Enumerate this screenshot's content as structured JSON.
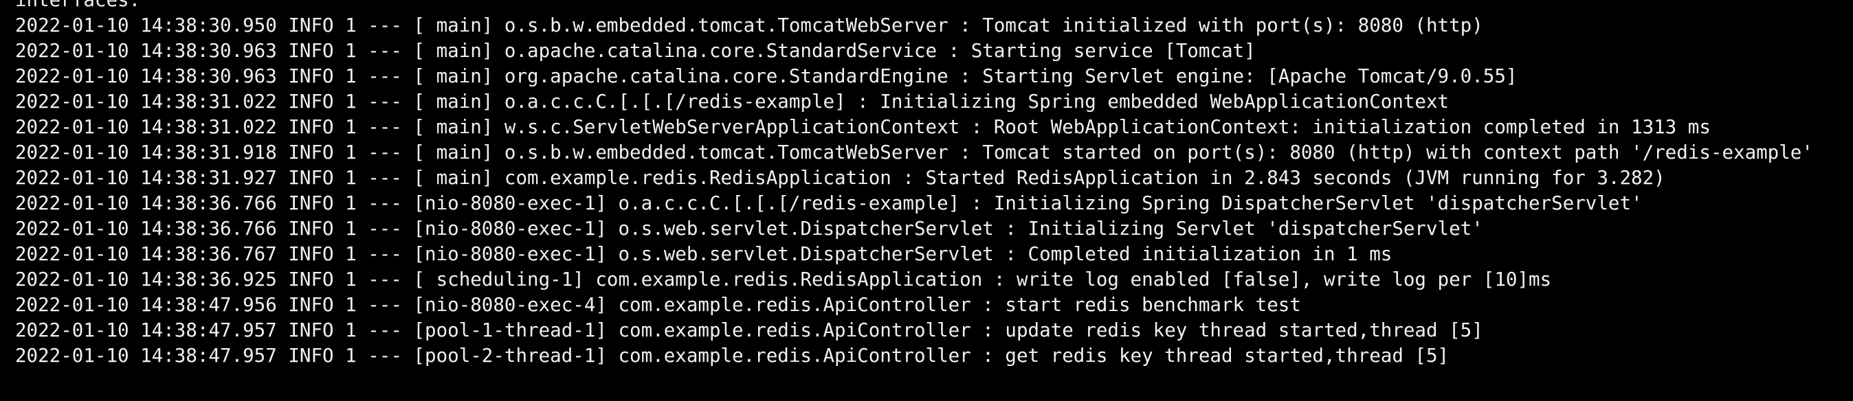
{
  "terminal": {
    "background": "#000000",
    "foreground": "#f0f0f0",
    "lines": [
      "interfaces.",
      "2022-01-10 14:38:30.950 INFO 1 --- [ main] o.s.b.w.embedded.tomcat.TomcatWebServer : Tomcat initialized with port(s): 8080 (http)",
      "2022-01-10 14:38:30.963 INFO 1 --- [ main] o.apache.catalina.core.StandardService : Starting service [Tomcat]",
      "2022-01-10 14:38:30.963 INFO 1 --- [ main] org.apache.catalina.core.StandardEngine : Starting Servlet engine: [Apache Tomcat/9.0.55]",
      "2022-01-10 14:38:31.022 INFO 1 --- [ main] o.a.c.c.C.[.[.[/redis-example] : Initializing Spring embedded WebApplicationContext",
      "2022-01-10 14:38:31.022 INFO 1 --- [ main] w.s.c.ServletWebServerApplicationContext : Root WebApplicationContext: initialization completed in 1313 ms",
      "2022-01-10 14:38:31.918 INFO 1 --- [ main] o.s.b.w.embedded.tomcat.TomcatWebServer : Tomcat started on port(s): 8080 (http) with context path '/redis-example'",
      "2022-01-10 14:38:31.927 INFO 1 --- [ main] com.example.redis.RedisApplication : Started RedisApplication in 2.843 seconds (JVM running for 3.282)",
      "2022-01-10 14:38:36.766 INFO 1 --- [nio-8080-exec-1] o.a.c.c.C.[.[.[/redis-example] : Initializing Spring DispatcherServlet 'dispatcherServlet'",
      "2022-01-10 14:38:36.766 INFO 1 --- [nio-8080-exec-1] o.s.web.servlet.DispatcherServlet : Initializing Servlet 'dispatcherServlet'",
      "2022-01-10 14:38:36.767 INFO 1 --- [nio-8080-exec-1] o.s.web.servlet.DispatcherServlet : Completed initialization in 1 ms",
      "2022-01-10 14:38:36.925 INFO 1 --- [ scheduling-1] com.example.redis.RedisApplication : write log enabled [false], write log per [10]ms",
      "2022-01-10 14:38:47.956 INFO 1 --- [nio-8080-exec-4] com.example.redis.ApiController : start redis benchmark test",
      "2022-01-10 14:38:47.957 INFO 1 --- [pool-1-thread-1] com.example.redis.ApiController : update redis key thread started,thread [5]",
      "2022-01-10 14:38:47.957 INFO 1 --- [pool-2-thread-1] com.example.redis.ApiController : get redis key thread started,thread [5]"
    ]
  }
}
